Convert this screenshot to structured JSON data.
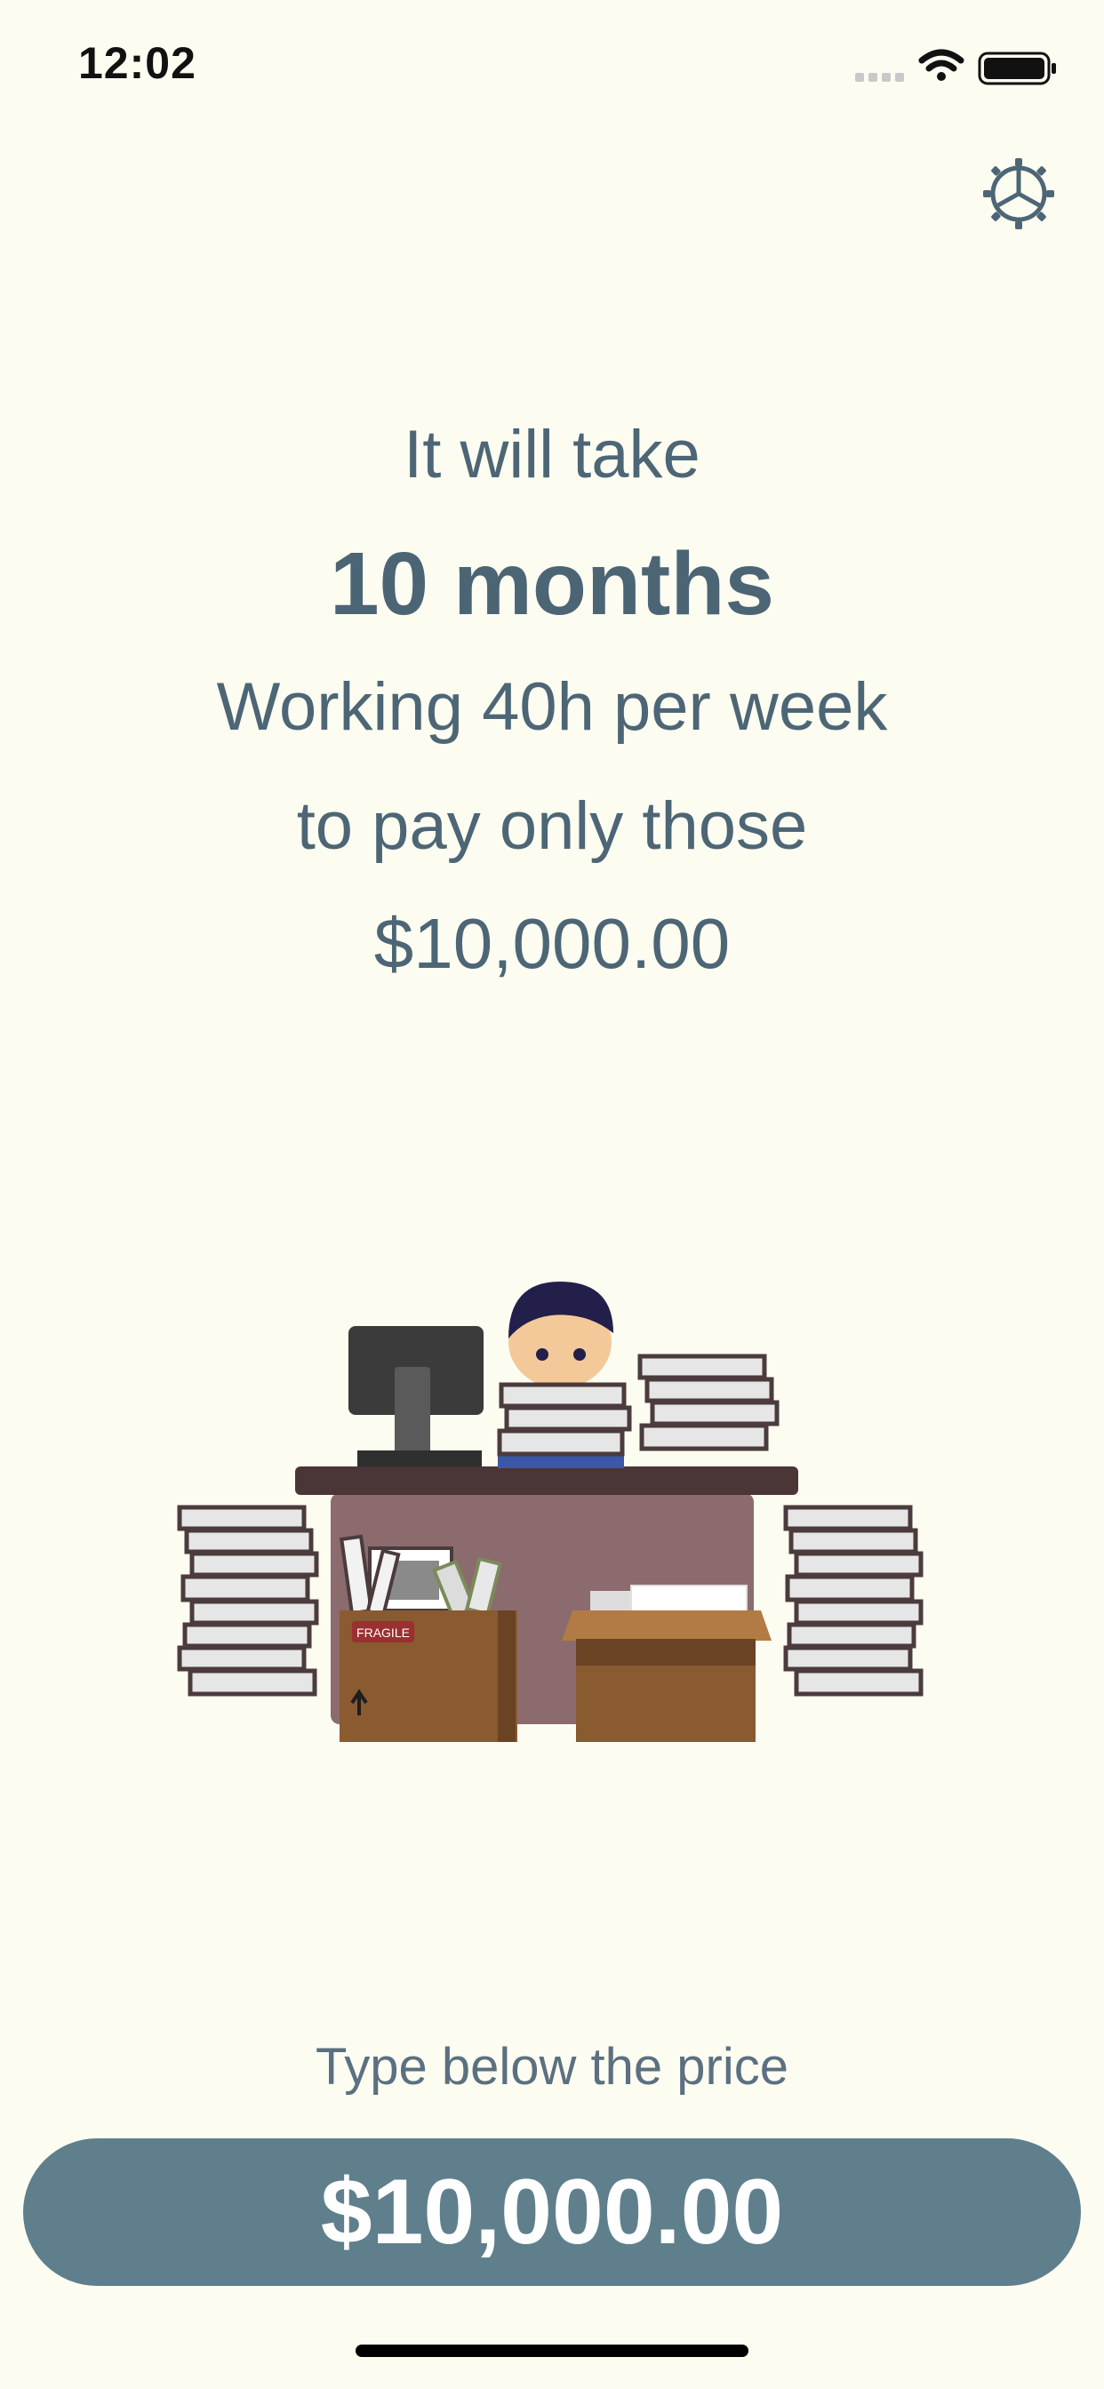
{
  "status_bar": {
    "time": "12:02",
    "icons": [
      "signal-icon",
      "wifi-icon",
      "battery-icon"
    ]
  },
  "settings": {
    "icon": "gear-icon"
  },
  "result": {
    "line1": "It will take",
    "duration": "10 months",
    "line3": "Working 40h per week",
    "line4": "to pay only those",
    "amount": "$10,000.00"
  },
  "illustration": {
    "label": "FRAGILE"
  },
  "input": {
    "hint": "Type below the price",
    "value": "$10,000.00"
  },
  "colors": {
    "background": "#fdfcf1",
    "text": "#4d6676",
    "input_background": "#5f7f8d",
    "input_text": "#ffffff"
  }
}
